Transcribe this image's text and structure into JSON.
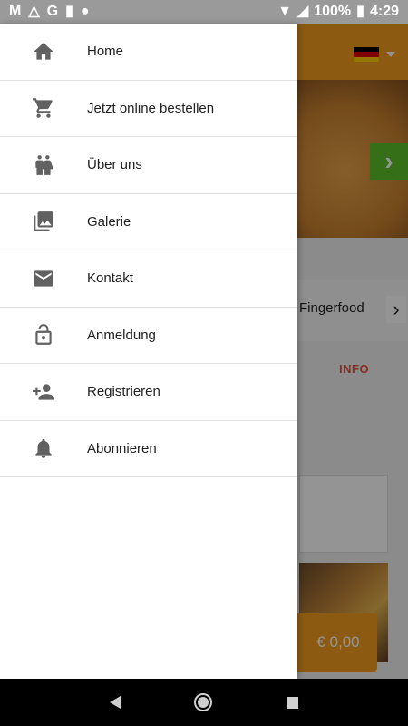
{
  "status_bar": {
    "battery": "100%",
    "time": "4:29",
    "left_icons": [
      "gmail-icon",
      "drive-icon",
      "google-icon",
      "sd-card-icon",
      "circle-icon"
    ],
    "right_icons": [
      "wifi-icon",
      "signal-icon",
      "battery-icon"
    ]
  },
  "drawer": {
    "items": [
      {
        "label": "Home",
        "icon": "home-icon"
      },
      {
        "label": "Jetzt online bestellen",
        "icon": "cart-icon"
      },
      {
        "label": "Über uns",
        "icon": "people-icon"
      },
      {
        "label": "Galerie",
        "icon": "gallery-icon"
      },
      {
        "label": "Kontakt",
        "icon": "mail-icon"
      },
      {
        "label": "Anmeldung",
        "icon": "lock-open-icon"
      },
      {
        "label": "Registrieren",
        "icon": "person-add-icon"
      },
      {
        "label": "Abonnieren",
        "icon": "bell-icon"
      }
    ]
  },
  "background": {
    "category_label": "Fingerfood",
    "info_tab": "INFO",
    "price": "€ 0,00",
    "toolbar_color": "#f39c1f",
    "accent_green": "#5cc22a"
  }
}
